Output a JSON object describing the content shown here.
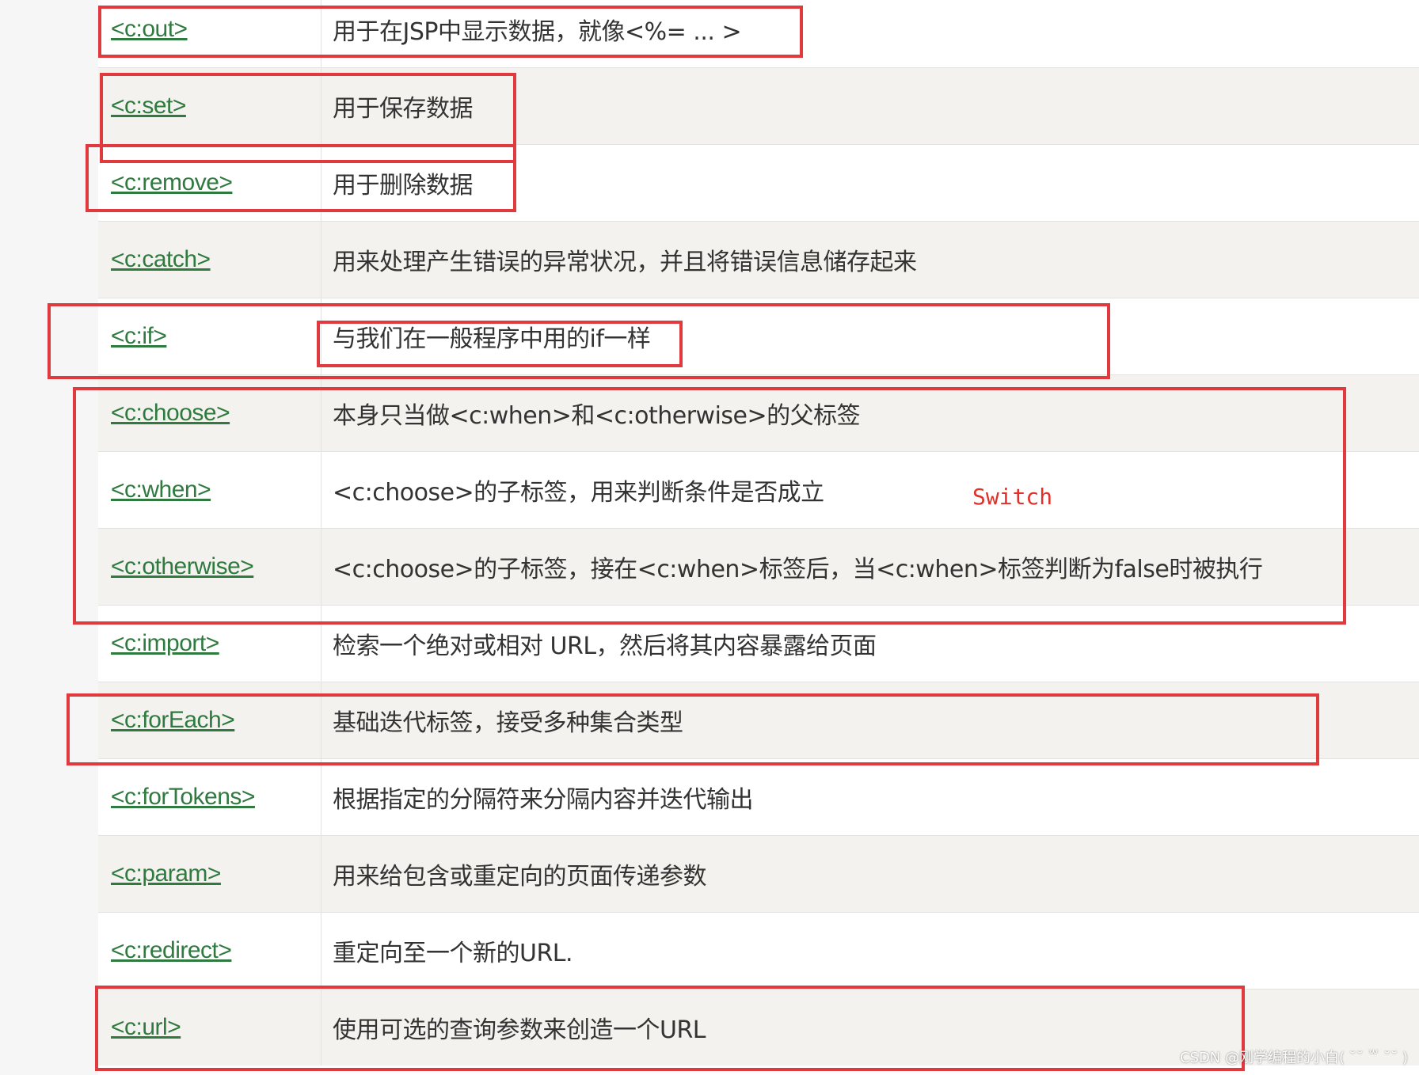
{
  "rows": [
    {
      "tag": "<c:out>",
      "desc": "用于在JSP中显示数据，就像<%= ... >"
    },
    {
      "tag": "<c:set>",
      "desc": "用于保存数据"
    },
    {
      "tag": "<c:remove>",
      "desc": "用于删除数据"
    },
    {
      "tag": "<c:catch>",
      "desc": "用来处理产生错误的异常状况，并且将错误信息储存起来"
    },
    {
      "tag": "<c:if>",
      "desc": "与我们在一般程序中用的if一样"
    },
    {
      "tag": "<c:choose>",
      "desc": "本身只当做<c:when>和<c:otherwise>的父标签"
    },
    {
      "tag": "<c:when>",
      "desc": "<c:choose>的子标签，用来判断条件是否成立"
    },
    {
      "tag": "<c:otherwise>",
      "desc": "<c:choose>的子标签，接在<c:when>标签后，当<c:when>标签判断为false时被执行"
    },
    {
      "tag": "<c:import>",
      "desc": "检索一个绝对或相对 URL，然后将其内容暴露给页面"
    },
    {
      "tag": "<c:forEach>",
      "desc": "基础迭代标签，接受多种集合类型"
    },
    {
      "tag": "<c:forTokens>",
      "desc": "根据指定的分隔符来分隔内容并迭代输出"
    },
    {
      "tag": "<c:param>",
      "desc": "用来给包含或重定向的页面传递参数"
    },
    {
      "tag": "<c:redirect>",
      "desc": "重定向至一个新的URL."
    },
    {
      "tag": "<c:url>",
      "desc": "使用可选的查询参数来创造一个URL"
    }
  ],
  "annotation": {
    "switch_label": "Switch"
  },
  "watermark": {
    "text": "CSDN @刚学编程的小白( ˘˘ ꒳ ˘˘ )"
  },
  "colors": {
    "link": "#2f7a3f",
    "highlight": "#e0393e",
    "annotation": "#e0302a"
  }
}
